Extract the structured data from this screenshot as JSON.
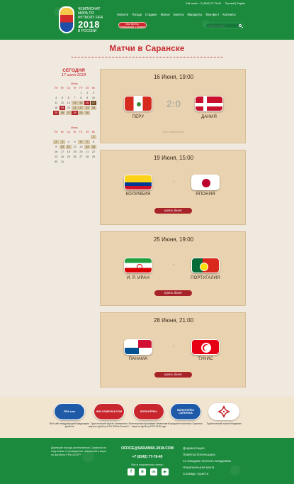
{
  "header": {
    "brand_line1": "Чемпионат",
    "brand_line2": "мира по",
    "brand_line3": "футболу FIFA",
    "brand_year": "2018",
    "brand_country": "в России",
    "contacts": "Call center: +7 (8342) 77-78-40",
    "languages": "Русский | English",
    "nav": [
      "Новости",
      "Погода",
      "Стадион",
      "Жилье",
      "Билеты",
      "Маршруты",
      "Фан-фест",
      "Контакты"
    ],
    "ticket_button": "Мои билеты. Информация о поездке",
    "search_placeholder": "поиск по сайту"
  },
  "page": {
    "title": "Матчи в Саранске"
  },
  "sidebar": {
    "today_label": "СЕГОДНЯ",
    "today_date": "17 июня 2018",
    "weekdays": [
      "Пн",
      "Вт",
      "Ср",
      "Чт",
      "Пт",
      "Сб",
      "Вс"
    ],
    "june": {
      "month": "Июнь",
      "lead": 4,
      "days": [
        "1",
        "2",
        "3",
        "4",
        "5",
        "6",
        "7",
        "8",
        "9",
        "10",
        "11",
        "12",
        "13",
        "14",
        "15",
        "16",
        "17",
        "18",
        "19",
        "20",
        "21",
        "22",
        "23",
        "24",
        "25",
        "26",
        "27",
        "28",
        "29",
        "30"
      ]
    },
    "july": {
      "month": "Июль",
      "lead": 6,
      "days": [
        "1",
        "2",
        "3",
        "4",
        "5",
        "6",
        "7",
        "8",
        "9",
        "10",
        "11",
        "12",
        "13",
        "14",
        "15",
        "16",
        "17",
        "18",
        "19",
        "20",
        "21",
        "22",
        "23",
        "24",
        "25",
        "26",
        "27",
        "28",
        "29",
        "30",
        "31"
      ]
    }
  },
  "matches": [
    {
      "date": "16 Июня, 19:00",
      "home": "ПЕРУ",
      "away": "ДАНИЯ",
      "score": "2:0",
      "status": "Матч завершился",
      "home_flag": "peru",
      "away_flag": "denmark"
    },
    {
      "date": "19 Июня, 15:00",
      "home": "КОЛУМБИЯ",
      "away": "ЯПОНИЯ",
      "separator": "•",
      "button": "купить билет",
      "home_flag": "colombia",
      "away_flag": "japan"
    },
    {
      "date": "25 Июня, 19:00",
      "home": "И. Р. ИРАН",
      "away": "ПОРТУГАЛИЯ",
      "separator": "•",
      "button": "купить билет",
      "home_flag": "iran",
      "away_flag": "portugal"
    },
    {
      "date": "28 Июня, 21:00",
      "home": "ПАНАМА",
      "away": "ТУНИС",
      "separator": "•",
      "button": "купить билет",
      "home_flag": "panama",
      "away_flag": "tunisia"
    }
  ],
  "partners": [
    {
      "name": "FIFA.com",
      "caption": "Веб-сайт международной федерации футбола",
      "color": "#1e5aa8"
    },
    {
      "name": "WELCOME2018.COM",
      "caption": "Туристический портал Чемпионата мира по футболу FIFA 2018 в России™",
      "color": "#c8262c"
    },
    {
      "name": "ВОЛОНТЕРЫ",
      "caption": "Волонтерская программа Чемпионата мира по футболу FIFA 2018 года",
      "color": "#c8262c"
    },
    {
      "name": "ВОЛОНТЕРЫ САРАНСКА",
      "caption": "Городские волонтеры Саранска",
      "color": "#1e5aa8"
    },
    {
      "name": "",
      "caption": "Туристический портал Мордовии",
      "color": "#ffffff"
    }
  ],
  "footer": {
    "about": "Дирекция города-организатора Саранска по подготовке и проведению Чемпионата мира по футболу FIFA 2018™",
    "email": "OFFICE@SARANSK-2018.COM",
    "phone": "+7 (8342) 77-78-40",
    "social_label": "Мы в социальных сетях:",
    "social": [
      "f",
      "в",
      "ok",
      "▶"
    ],
    "links": [
      "Документация",
      "Памятка болельщика",
      "13 поводов посетить Мордовию",
      "Национальная кухня",
      "Словарь туриста"
    ]
  }
}
